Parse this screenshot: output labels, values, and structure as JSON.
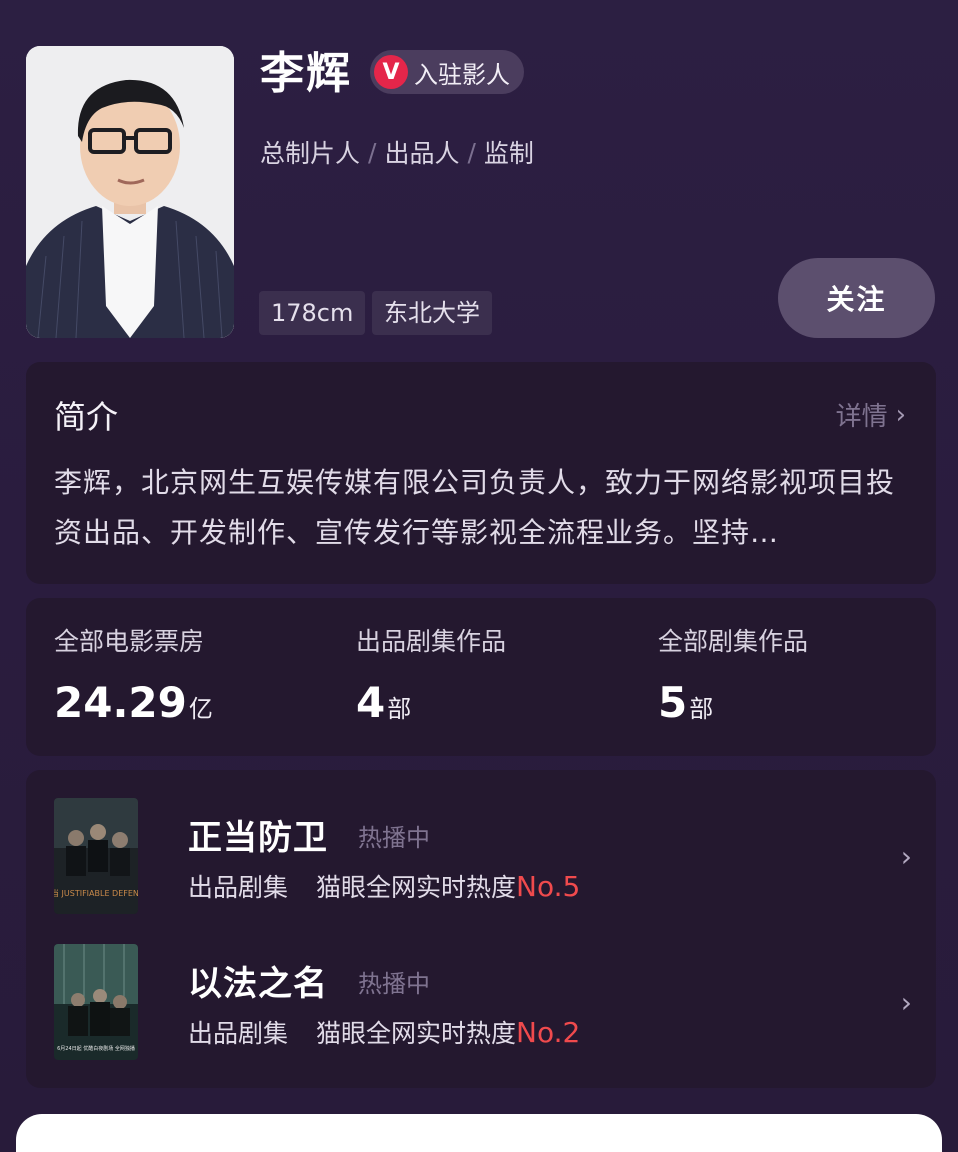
{
  "profile": {
    "name": "李辉",
    "badge_icon": "V",
    "badge_label": "入驻影人",
    "roles": [
      "总制片人",
      "出品人",
      "监制"
    ],
    "role_separator": "/",
    "tags": [
      "178cm",
      "东北大学"
    ],
    "follow_label": "关注"
  },
  "intro": {
    "title": "简介",
    "more_label": "详情",
    "text": "李辉，北京网生互娱传媒有限公司负责人，致力于网络影视项目投资出品、开发制作、宣传发行等影视全流程业务。坚持…"
  },
  "stats": [
    {
      "label": "全部电影票房",
      "value": "24.29",
      "unit": "亿"
    },
    {
      "label": "出品剧集作品",
      "value": "4",
      "unit": "部"
    },
    {
      "label": "全部剧集作品",
      "value": "5",
      "unit": "部"
    }
  ],
  "works": [
    {
      "title": "正当防卫",
      "status": "热播中",
      "type": "出品剧集",
      "heat_label": "猫眼全网实时热度",
      "rank": "No.5",
      "poster_text": "正当 JUSTIFIABLE DEFENSE"
    },
    {
      "title": "以法之名",
      "status": "热播中",
      "type": "出品剧集",
      "heat_label": "猫眼全网实时热度",
      "rank": "No.2",
      "poster_text": "6月24日起 优酷白夜剧场 全网独播"
    }
  ],
  "colors": {
    "accent": "#e4264a",
    "rank": "#f04a4d",
    "background": "#2a1d3f",
    "card": "#24182f"
  },
  "icons": {
    "verified": "verified-v-icon",
    "chevron": "chevron-right-icon"
  }
}
